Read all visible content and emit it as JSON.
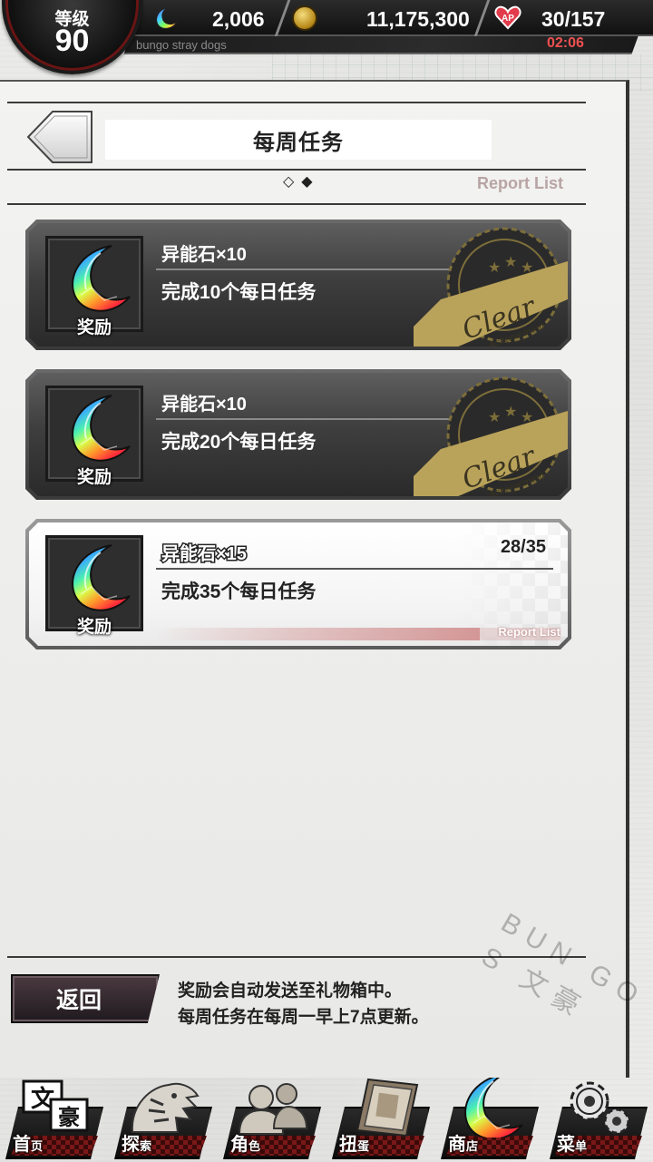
{
  "status": {
    "level_label": "等级",
    "level": "90",
    "gems": "2,006",
    "gold": "11,175,300",
    "stamina": "30/157",
    "timer": "02:06",
    "subtitle": "bungo stray dogs"
  },
  "header": {
    "title": "每周任务",
    "pager": "◇◆",
    "report_list": "Report List"
  },
  "missions": [
    {
      "reward_label": "奖励",
      "reward": "异能石×10",
      "desc": "完成10个每日任务",
      "state": "clear"
    },
    {
      "reward_label": "奖励",
      "reward": "异能石×10",
      "desc": "完成20个每日任务",
      "state": "clear"
    },
    {
      "reward_label": "奖励",
      "reward": "异能石×15",
      "desc": "完成35个每日任务",
      "state": "in-progress",
      "progress": "28/35",
      "progress_value": 0.8,
      "report_list": "Report List"
    }
  ],
  "footer": {
    "back_label": "返回",
    "notice_line1": "奖励会自动发送至礼物箱中。",
    "notice_line2": "每周任务在每周一早上7点更新。",
    "watermark": "BUN GO S 文豪"
  },
  "nav": [
    {
      "big": "首",
      "small": "页",
      "icon": "home-icon"
    },
    {
      "big": "探",
      "small": "索",
      "icon": "tiger-icon"
    },
    {
      "big": "角",
      "small": "色",
      "icon": "characters-icon"
    },
    {
      "big": "扭",
      "small": "蛋",
      "icon": "book-icon"
    },
    {
      "big": "商",
      "small": "店",
      "icon": "gem-icon"
    },
    {
      "big": "菜",
      "small": "单",
      "icon": "gear-icon"
    }
  ],
  "colors": {
    "accent_red": "#7a1818",
    "timer_red": "#f05050",
    "clear_gold": "#b9a25a"
  }
}
